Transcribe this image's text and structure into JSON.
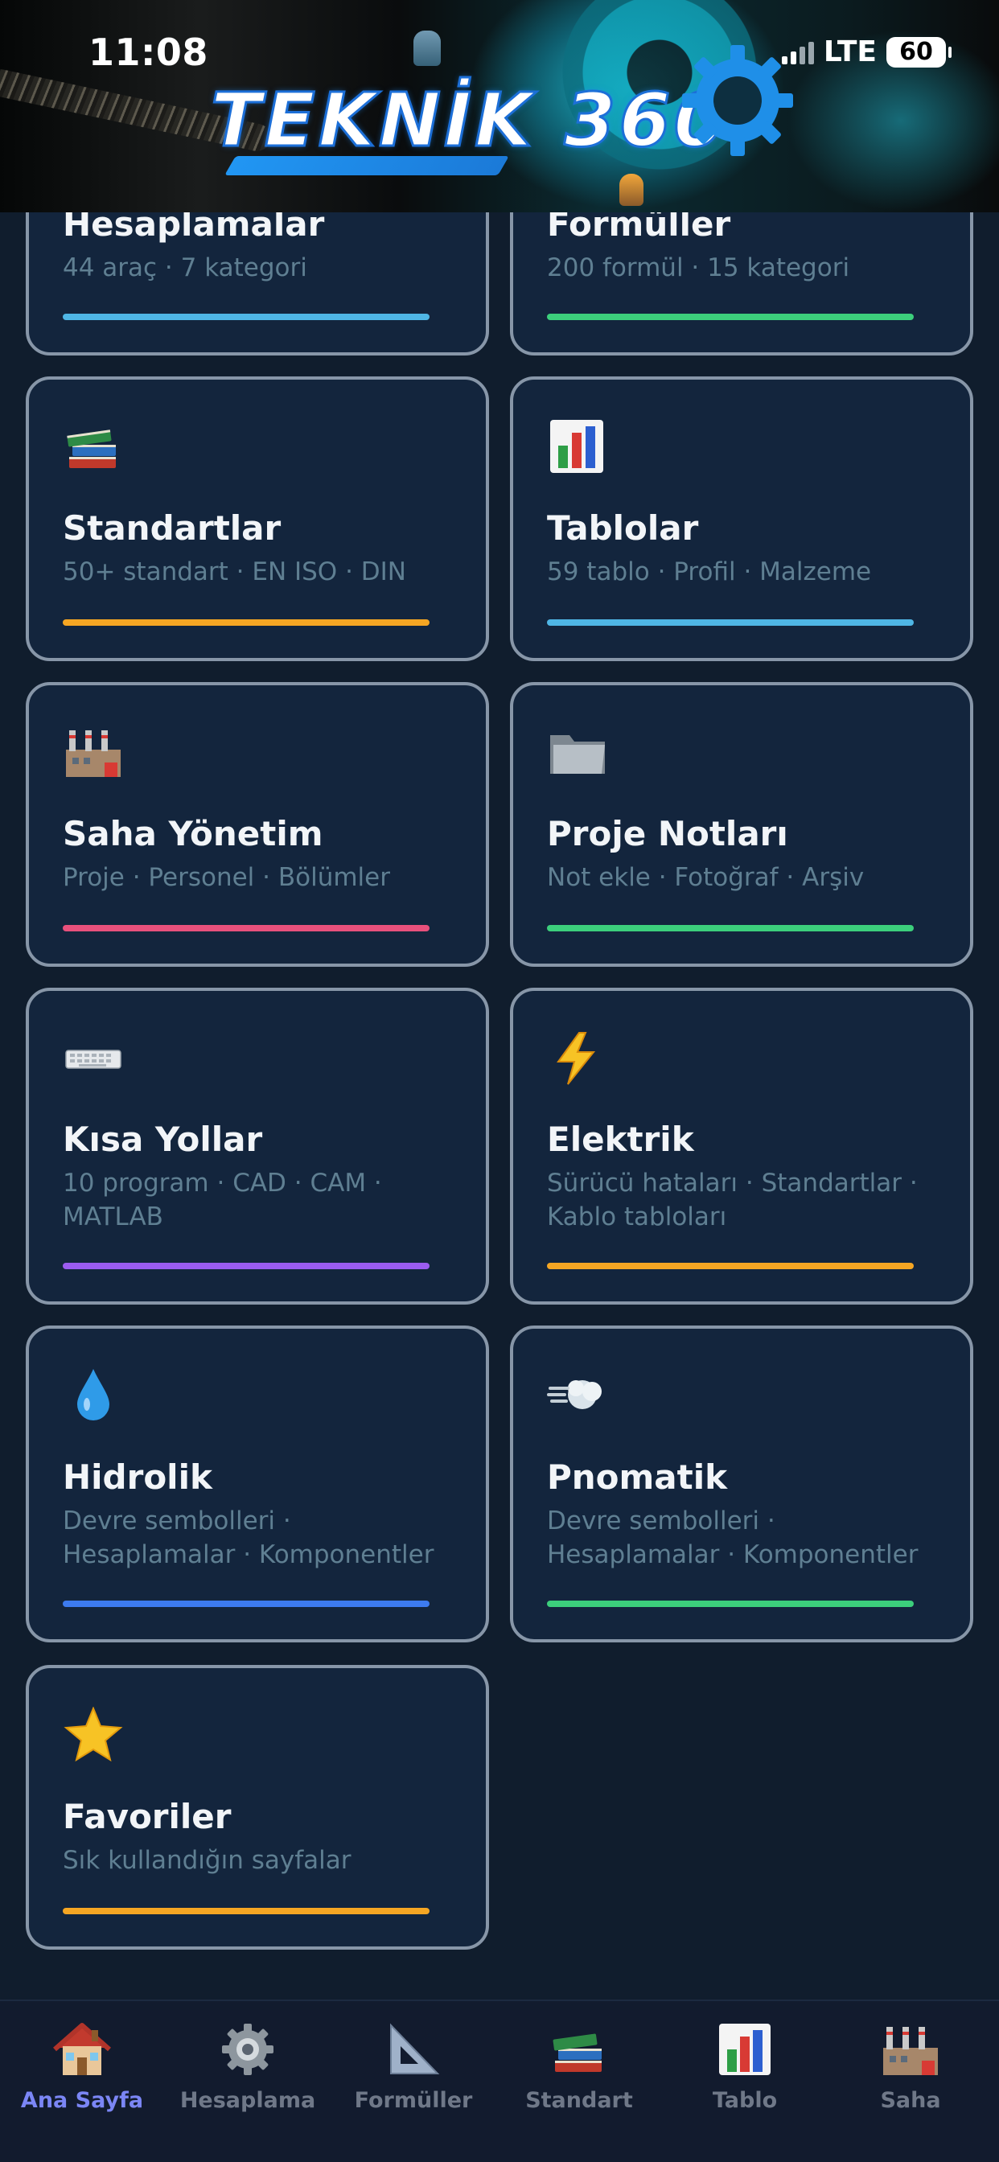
{
  "status_bar": {
    "time": "11:08",
    "network": "LTE",
    "battery": "60"
  },
  "header": {
    "logo_text": "TEKNİK 360"
  },
  "cards": [
    {
      "title": "Hesaplamalar",
      "subtitle": "44 araç · 7 kategori",
      "accent": "#4fb6e5",
      "icon": "calculator-icon"
    },
    {
      "title": "Formüller",
      "subtitle": "200 formül · 15 kategori",
      "accent": "#3ccf7c",
      "icon": "triangle-ruler-icon"
    },
    {
      "title": "Standartlar",
      "subtitle": "50+ standart · EN ISO · DIN",
      "accent": "#f5a623",
      "icon": "books-icon"
    },
    {
      "title": "Tablolar",
      "subtitle": "59 tablo · Profil · Malzeme",
      "accent": "#4fb6e5",
      "icon": "bar-chart-icon"
    },
    {
      "title": "Saha Yönetim",
      "subtitle": "Proje · Personel · Bölümler",
      "accent": "#e8507c",
      "icon": "factory-icon"
    },
    {
      "title": "Proje Notları",
      "subtitle": "Not ekle · Fotoğraf · Arşiv",
      "accent": "#3ccf7c",
      "icon": "folder-icon"
    },
    {
      "title": "Kısa Yollar",
      "subtitle": "10 program · CAD · CAM · MATLAB",
      "accent": "#9b5cf0",
      "icon": "keyboard-icon"
    },
    {
      "title": "Elektrik",
      "subtitle": "Sürücü hataları · Standartlar · Kablo tabloları",
      "accent": "#f5a623",
      "icon": "lightning-icon"
    },
    {
      "title": "Hidrolik",
      "subtitle": "Devre sembolleri · Hesaplamalar · Komponentler",
      "accent": "#3d7bef",
      "icon": "water-drop-icon"
    },
    {
      "title": "Pnomatik",
      "subtitle": "Devre sembolleri · Hesaplamalar · Komponentler",
      "accent": "#3ccf7c",
      "icon": "wind-icon"
    },
    {
      "title": "Favoriler",
      "subtitle": "Sık kullandığın sayfalar",
      "accent": "#f5a623",
      "icon": "star-icon"
    }
  ],
  "tabs": [
    {
      "label": "Ana Sayfa",
      "icon": "house-icon",
      "active": true
    },
    {
      "label": "Hesaplama",
      "icon": "gear-icon",
      "active": false
    },
    {
      "label": "Formüller",
      "icon": "triangle-ruler-icon",
      "active": false
    },
    {
      "label": "Standart",
      "icon": "books-icon",
      "active": false
    },
    {
      "label": "Tablo",
      "icon": "bar-chart-icon",
      "active": false
    },
    {
      "label": "Saha",
      "icon": "factory-icon",
      "active": false
    }
  ]
}
